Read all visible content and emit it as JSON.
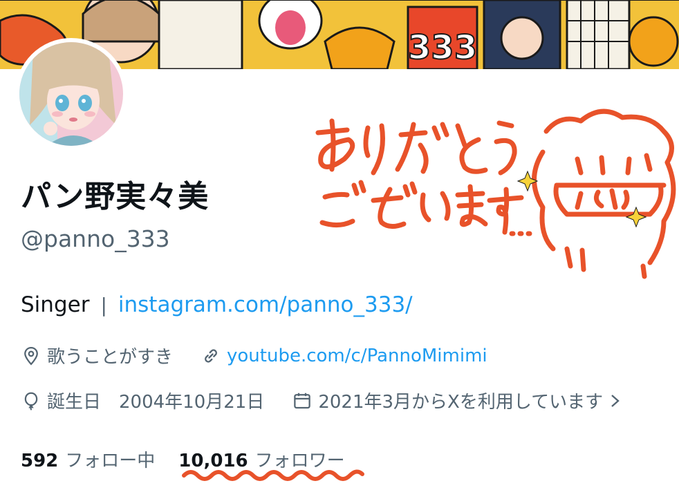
{
  "profile": {
    "display_name": "パン野実々美",
    "handle": "@panno_333",
    "bio_text": "Singer",
    "bio_separator": "|",
    "bio_link": "instagram.com/panno_333/",
    "location": "歌うことがすき",
    "website": "youtube.com/c/PannoMimimi",
    "birthday": "誕生日　2004年10月21日",
    "joined": "2021年3月からXを利用しています",
    "following_count": "592",
    "following_label": "フォロー中",
    "followers_count": "10,016",
    "followers_label": "フォロワー"
  },
  "icons": {
    "location": "location-pin-icon",
    "website": "link-icon",
    "birthday": "balloon-icon",
    "joined": "calendar-icon",
    "more": "chevron-right-icon"
  },
  "annotation": {
    "text": "ありがとうございます…",
    "color": "#e8522a"
  },
  "colors": {
    "link": "#1d9bf0",
    "secondary_text": "#536471",
    "primary_text": "#0f1419"
  }
}
